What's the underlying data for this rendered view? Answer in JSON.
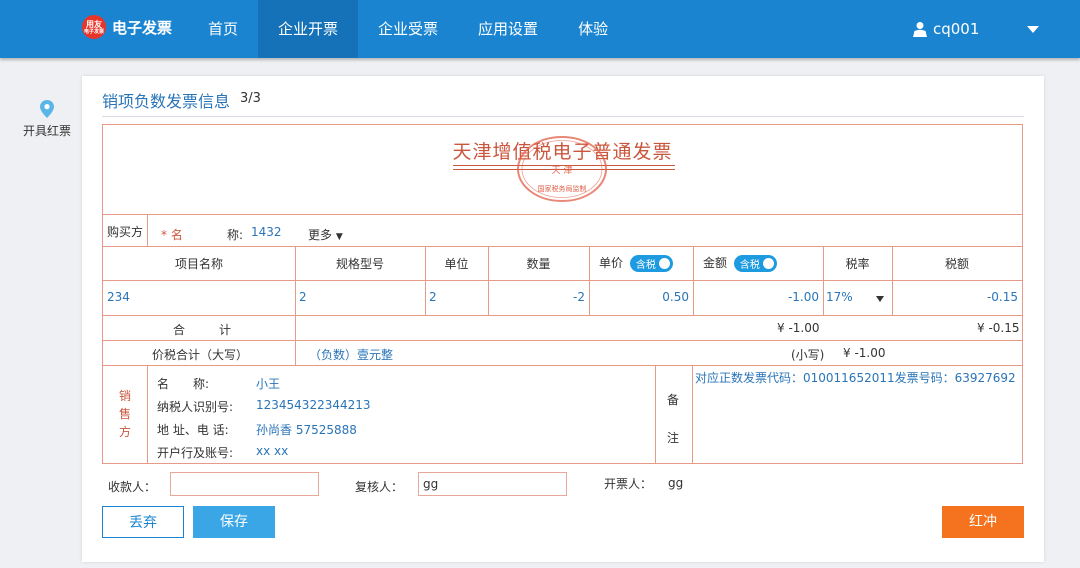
{
  "app": {
    "logo_badge_top": "用友",
    "logo_badge_bottom": "电子发票",
    "name": "电子发票"
  },
  "nav": {
    "items": [
      "首页",
      "企业开票",
      "企业受票",
      "应用设置",
      "体验"
    ],
    "active_index": 1
  },
  "user": {
    "name": "cq001",
    "icon": "user-icon"
  },
  "sidebar": {
    "label": "开具红票",
    "icon": "map-pin-icon"
  },
  "panel": {
    "title": "销项负数发票信息",
    "count": "3/3"
  },
  "invoice": {
    "title": "天津增值税电子普通发票",
    "seal": {
      "center": "天 津",
      "arc_bottom": "国家税务局监制"
    },
    "buyer": {
      "section": "购买方",
      "name_label": "* 名",
      "name_label2": "称:",
      "name_value": "1432",
      "more": "更多"
    },
    "columns": [
      "项目名称",
      "规格型号",
      "单位",
      "数量",
      "单价",
      "金额",
      "税率",
      "税额"
    ],
    "tax_toggle_label": "含税",
    "item": {
      "name": "234",
      "spec": "2",
      "unit": "2",
      "quantity": "-2",
      "price": "0.50",
      "amount": "-1.00",
      "tax_rate": "17%",
      "tax": "-0.15"
    },
    "total": {
      "label1": "合",
      "label2": "计",
      "amount": "¥ -1.00",
      "tax": "¥ -0.15"
    },
    "grand_total": {
      "label": "价税合计（大写）",
      "words": "（负数）壹元整",
      "small_label": "(小写)",
      "small_value": "¥ -1.00"
    },
    "seller": {
      "section_chars": [
        "销",
        "售",
        "方"
      ],
      "name_label": "名　　称:",
      "name_value": "小王",
      "tax_id_label": "纳税人识别号:",
      "tax_id_value": "123454322344213",
      "address_label": "地 址、电 话:",
      "address_value": "孙尚香 57525888",
      "bank_label": "开户行及账号:",
      "bank_value": "xx xx"
    },
    "remark": {
      "label_chars": [
        "备",
        "注"
      ],
      "text": "对应正数发票代码：010011652011发票号码：63927692"
    }
  },
  "footer": {
    "payee_label": "收款人：",
    "payee_value": "",
    "reviewer_label": "复核人：",
    "reviewer_value": "gg",
    "issuer_label": "开票人：",
    "issuer_value": "gg"
  },
  "buttons": {
    "discard": "丢弃",
    "save": "保存",
    "red": "红冲"
  },
  "colors": {
    "nav_bg": "#1b84d0",
    "nav_active": "#1572b8",
    "invoice_border": "#e79b86",
    "invoice_red": "#c9573e",
    "link_blue": "#2a74b8",
    "toggle_blue": "#1e9be0",
    "save_button": "#3aa6e6",
    "red_button": "#f5731f"
  }
}
